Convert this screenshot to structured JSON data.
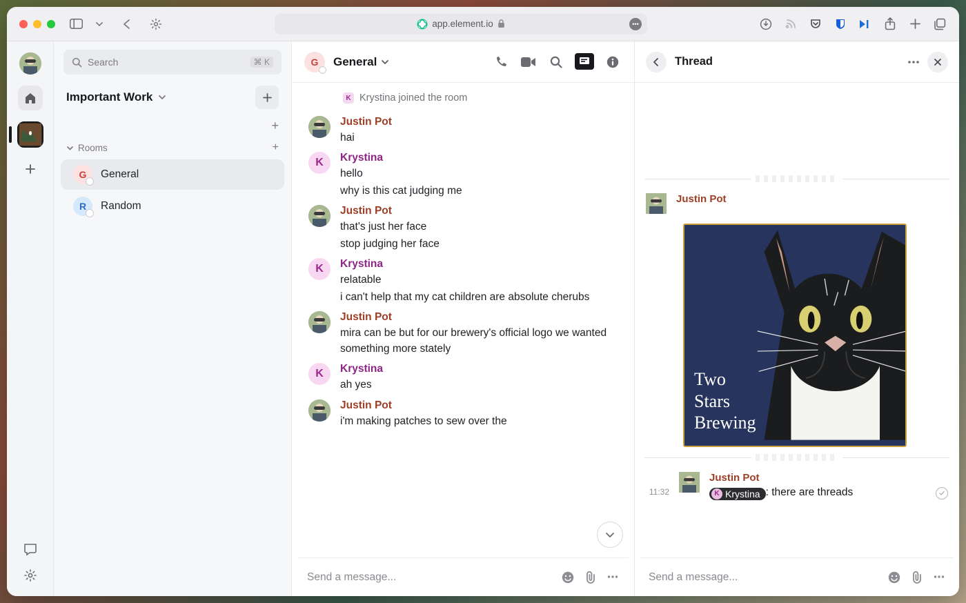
{
  "titlebar": {
    "url": "app.element.io"
  },
  "search": {
    "placeholder": "Search",
    "shortcut": "⌘ K"
  },
  "space": {
    "name": "Important Work"
  },
  "sections": {
    "rooms_label": "Rooms"
  },
  "rooms": [
    {
      "letter": "G",
      "name": "General",
      "color": "#fde1e1",
      "fg": "#c3433d",
      "active": true
    },
    {
      "letter": "R",
      "name": "Random",
      "color": "#d6e8fb",
      "fg": "#2e6bbf",
      "active": false
    }
  ],
  "chat": {
    "room_letter": "G",
    "room_name": "General",
    "system_event": "Krystina joined the room",
    "messages": [
      {
        "author": "Justin Pot",
        "cls": "jp",
        "lines": [
          "hai"
        ]
      },
      {
        "author": "Krystina",
        "cls": "kr",
        "lines": [
          "hello",
          "why is this cat judging me"
        ]
      },
      {
        "author": "Justin Pot",
        "cls": "jp",
        "lines": [
          "that's just her face",
          "stop judging her face"
        ]
      },
      {
        "author": "Krystina",
        "cls": "kr",
        "lines": [
          "relatable",
          "i can't help that my cat children are absolute cherubs"
        ]
      },
      {
        "author": "Justin Pot",
        "cls": "jp",
        "lines": [
          "mira can be but for our brewery's official logo we wanted something more stately"
        ]
      },
      {
        "author": "Krystina",
        "cls": "kr",
        "lines": [
          "ah yes"
        ]
      },
      {
        "author": "Justin Pot",
        "cls": "jp",
        "lines": [
          "i'm making patches to sew over the"
        ]
      }
    ],
    "composer_placeholder": "Send a message..."
  },
  "thread": {
    "title": "Thread",
    "root_author": "Justin Pot",
    "image_text_l1": "Two",
    "image_text_l2": "Stars",
    "image_text_l3": "Brewing",
    "reply_time": "11:32",
    "reply_author": "Justin Pot",
    "reply_mention": "Krystina",
    "reply_text": ": there are threads",
    "composer_placeholder": "Send a message..."
  }
}
